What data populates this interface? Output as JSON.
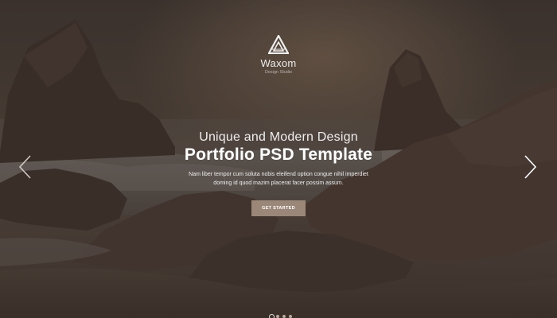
{
  "brand": {
    "name": "Waxom",
    "tagline": "Design Studio",
    "logo_icon": "triangle-logo-icon"
  },
  "hero": {
    "headline": "Unique and Modern Design",
    "title": "Portfolio PSD Template",
    "description": "Nam liber tempor cum soluta nobis eleifend option congue nihil imperdiet doming id quod mazim placerat facer possim assum.",
    "cta_label": "GET STARTED",
    "background": "dark rocky seascape at dusk"
  },
  "slider": {
    "prev_icon": "chevron-left-icon",
    "next_icon": "chevron-right-icon",
    "dot_count": 4,
    "active_dot": 1
  },
  "colors": {
    "overlay": "#3a2f29",
    "button": "#9b8778",
    "text": "#ffffff"
  }
}
